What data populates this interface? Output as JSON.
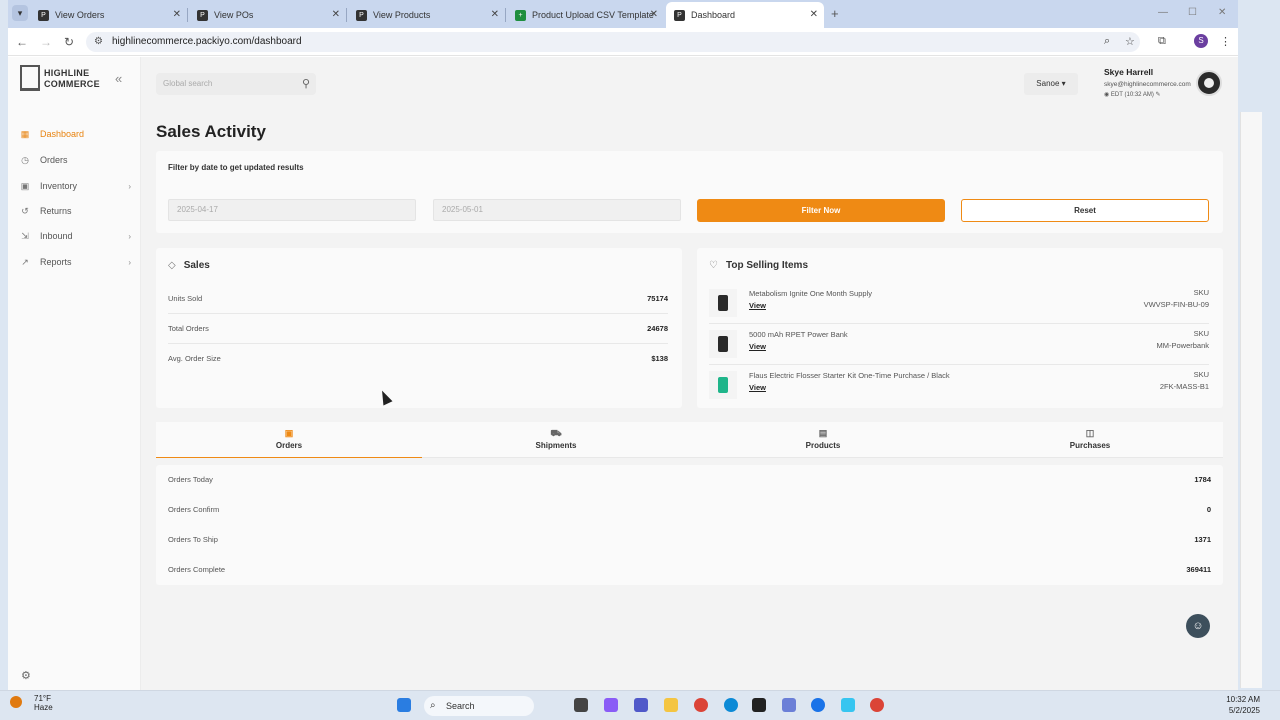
{
  "browser": {
    "tabs": [
      {
        "title": "View Orders"
      },
      {
        "title": "View POs"
      },
      {
        "title": "View Products"
      },
      {
        "title": "Product Upload CSV Template"
      },
      {
        "title": "Dashboard"
      }
    ],
    "url": "highlinecommerce.packiyo.com/dashboard",
    "profile_initial": "S"
  },
  "logo": {
    "line1": "HIGHLINE",
    "line2": "COMMERCE"
  },
  "sidebar": {
    "items": [
      {
        "label": "Dashboard",
        "icon": "grid-icon"
      },
      {
        "label": "Orders",
        "icon": "clock-icon"
      },
      {
        "label": "Inventory",
        "icon": "box-icon"
      },
      {
        "label": "Returns",
        "icon": "return-icon"
      },
      {
        "label": "Inbound",
        "icon": "inbound-icon"
      },
      {
        "label": "Reports",
        "icon": "chart-icon"
      }
    ]
  },
  "header": {
    "search_placeholder": "Global search",
    "warehouse": "Sanoe",
    "user_name": "Skye Harrell",
    "user_email": "skye@highlinecommerce.com",
    "timezone": "EDT (10:32 AM)"
  },
  "page": {
    "title": "Sales Activity",
    "filter": {
      "label": "Filter by date to get updated results",
      "start_date": "2025-04-17",
      "end_date": "2025-05-01",
      "filter_button": "Filter Now",
      "reset_button": "Reset"
    },
    "sales": {
      "title": "Sales",
      "rows": [
        {
          "label": "Units Sold",
          "value": "75174"
        },
        {
          "label": "Total Orders",
          "value": "24678"
        },
        {
          "label": "Avg. Order Size",
          "value": "$138"
        }
      ]
    },
    "top_selling": {
      "title": "Top Selling Items",
      "view_label": "View",
      "sku_label": "SKU",
      "items": [
        {
          "name": "Metabolism Ignite One Month Supply",
          "sku": "VWVSP-FIN-BU-09"
        },
        {
          "name": "5000 mAh RPET Power Bank",
          "sku": "MM-Powerbank"
        },
        {
          "name": "Flaus Electric Flosser Starter Kit One-Time Purchase / Black",
          "sku": "2FK-MASS-B1"
        }
      ]
    },
    "tabs": [
      {
        "label": "Orders"
      },
      {
        "label": "Shipments"
      },
      {
        "label": "Products"
      },
      {
        "label": "Purchases"
      }
    ],
    "orders": [
      {
        "label": "Orders Today",
        "value": "1784"
      },
      {
        "label": "Orders Confirm",
        "value": "0"
      },
      {
        "label": "Orders To Ship",
        "value": "1371"
      },
      {
        "label": "Orders Complete",
        "value": "369411"
      }
    ]
  },
  "taskbar": {
    "temp": "71°F",
    "condition": "Haze",
    "search": "Search",
    "time": "10:32 AM",
    "date": "5/2/2025"
  },
  "colors": {
    "accent": "#ef8a14",
    "sidebar_active": "#e8830f"
  }
}
